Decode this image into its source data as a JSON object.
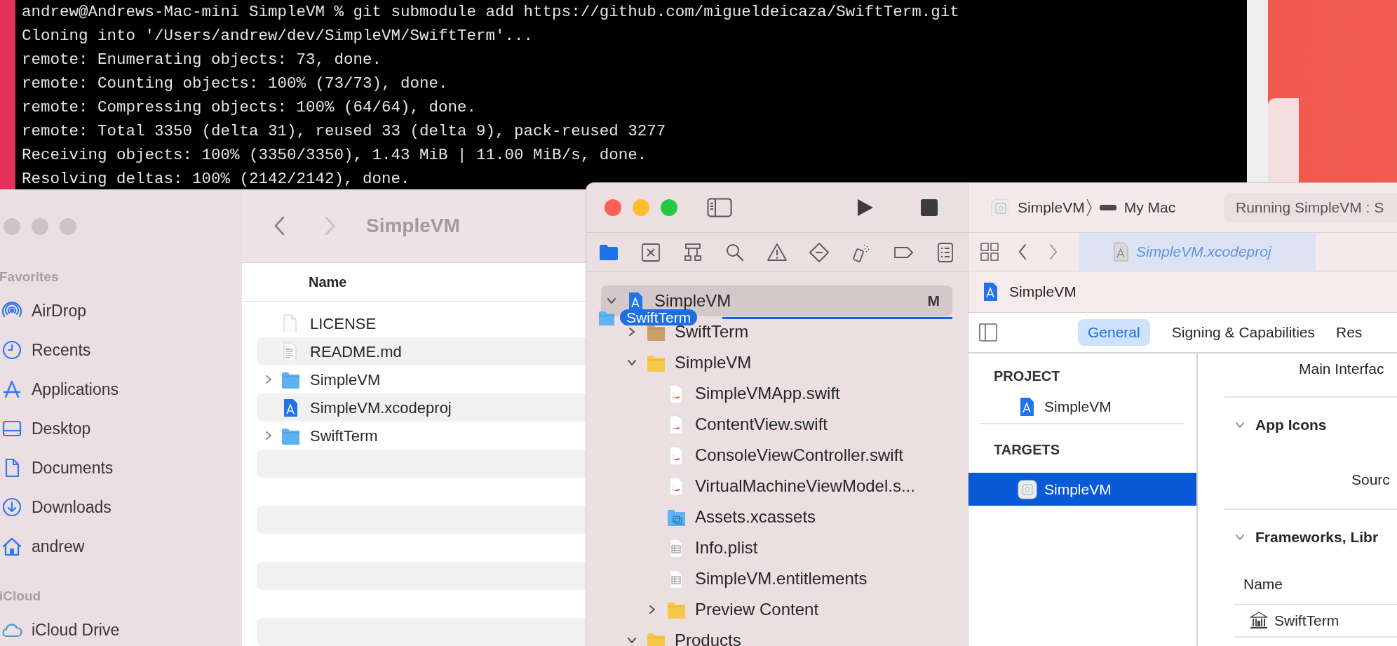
{
  "terminal": {
    "lines": [
      "andrew@Andrews-Mac-mini SimpleVM % git submodule add https://github.com/migueldeicaza/SwiftTerm.git",
      "Cloning into '/Users/andrew/dev/SimpleVM/SwiftTerm'...",
      "remote: Enumerating objects: 73, done.",
      "remote: Counting objects: 100% (73/73), done.",
      "remote: Compressing objects: 100% (64/64), done.",
      "remote: Total 3350 (delta 31), reused 33 (delta 9), pack-reused 3277",
      "Receiving objects: 100% (3350/3350), 1.43 MiB | 11.00 MiB/s, done.",
      "Resolving deltas: 100% (2142/2142), done."
    ]
  },
  "finder": {
    "title": "SimpleVM",
    "sidebar": [
      {
        "kind": "header",
        "label": "Favorites"
      },
      {
        "kind": "item",
        "label": "AirDrop"
      },
      {
        "kind": "item",
        "label": "Recents"
      },
      {
        "kind": "item",
        "label": "Applications"
      },
      {
        "kind": "item",
        "label": "Desktop"
      },
      {
        "kind": "item",
        "label": "Documents"
      },
      {
        "kind": "item",
        "label": "Downloads"
      },
      {
        "kind": "item",
        "label": "andrew"
      },
      {
        "kind": "header",
        "label": "iCloud"
      },
      {
        "kind": "cloud",
        "label": "iCloud Drive"
      }
    ],
    "columns": [
      "Name"
    ],
    "rows": [
      {
        "kind": "file",
        "name": "LICENSE"
      },
      {
        "kind": "readme",
        "name": "README.md"
      },
      {
        "kind": "folder",
        "name": "SimpleVM",
        "expanded": false
      },
      {
        "kind": "project",
        "name": "SimpleVM.xcodeproj"
      },
      {
        "kind": "folder",
        "name": "SwiftTerm",
        "expanded": false
      }
    ]
  },
  "xcode": {
    "navigator_tabs": [
      {
        "selected": true
      },
      {
        "selected": false
      },
      {
        "selected": false
      },
      {
        "selected": false
      },
      {
        "selected": false
      },
      {
        "selected": false
      },
      {
        "selected": false
      },
      {
        "selected": false
      },
      {
        "selected": false
      }
    ],
    "tree": [
      {
        "kind": "project",
        "label": "SimpleVM",
        "badge": "M",
        "selected": true,
        "expanded": true,
        "children": [
          {
            "kind": "package",
            "label": "SwiftTerm",
            "selected": false,
            "expanded": false
          },
          {
            "kind": "folder",
            "label": "SimpleVM",
            "selected": false,
            "expanded": true,
            "children": [
              {
                "kind": "swift",
                "label": "SimpleVMApp.swift",
                "selected": false
              },
              {
                "kind": "swift",
                "label": "ContentView.swift",
                "selected": false
              },
              {
                "kind": "swift",
                "label": "ConsoleViewController.swift",
                "selected": false
              },
              {
                "kind": "swift",
                "label": "VirtualMachineViewModel.s...",
                "selected": false
              },
              {
                "kind": "assets",
                "label": "Assets.xcassets",
                "selected": false
              },
              {
                "kind": "plist",
                "label": "Info.plist",
                "selected": false
              },
              {
                "kind": "plist",
                "label": "SimpleVM.entitlements",
                "selected": false
              },
              {
                "kind": "folder",
                "label": "Preview Content",
                "selected": false,
                "expanded": false
              }
            ]
          },
          {
            "kind": "folder",
            "label": "Products",
            "selected": false,
            "expanded": true
          }
        ]
      }
    ],
    "drag": {
      "label": "SwiftTerm"
    },
    "scheme": "SimpleVM",
    "destination": "My Mac",
    "status": "Running SimpleVM : S",
    "editor_tabs": [
      {
        "label": "SimpleVM.xcodeproj",
        "selected": true
      }
    ],
    "project_title": "SimpleVM",
    "settings_tabs": [
      {
        "label": "General",
        "selected": true
      },
      {
        "label": "Signing & Capabilities",
        "selected": false
      },
      {
        "label": "Res",
        "selected": false
      }
    ],
    "target_sections": [
      {
        "header": "PROJECT",
        "items": [
          {
            "kind": "project",
            "label": "SimpleVM",
            "selected": false
          }
        ]
      },
      {
        "header": "TARGETS",
        "items": [
          {
            "kind": "app",
            "label": "SimpleVM",
            "selected": true
          }
        ]
      }
    ],
    "details": [
      {
        "kind": "field",
        "label": "Main Interfac"
      },
      {
        "kind": "section",
        "label": "App Icons",
        "expanded": true
      },
      {
        "kind": "field",
        "label": "Sourc"
      },
      {
        "kind": "section",
        "label": "Frameworks, Libr",
        "expanded": true
      },
      {
        "kind": "column",
        "label": "Name"
      },
      {
        "kind": "framework",
        "label": "SwiftTerm"
      }
    ]
  }
}
